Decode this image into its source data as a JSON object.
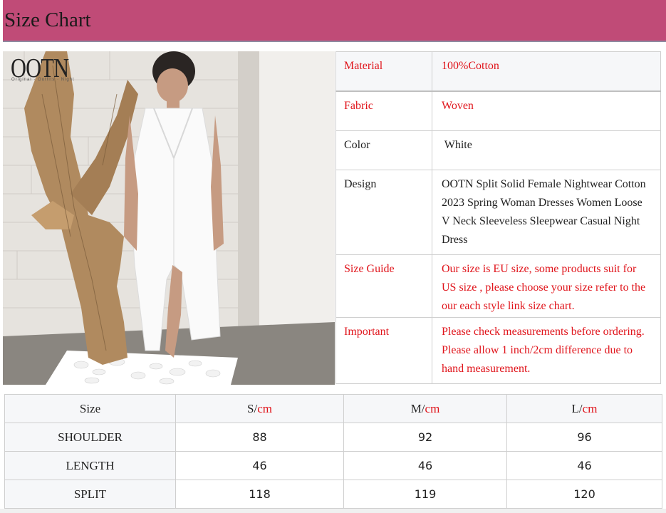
{
  "header": {
    "title": "Size Chart"
  },
  "photo": {
    "brand": "OOTN",
    "brand_tagline": "Original · Outfits · Night"
  },
  "spec": [
    {
      "label": "Material",
      "value": "100%Cotton",
      "color": "red"
    },
    {
      "label": "Fabric",
      "value": "Woven",
      "color": "red"
    },
    {
      "label": "Color",
      "value": " White",
      "color": "dark"
    },
    {
      "label": "Design",
      "value": "OOTN Split Solid Female Nightwear Cotton 2023 Spring Woman Dresses Women Loose V Neck Sleeveless Sleepwear Casual Night Dress",
      "color": "dark"
    },
    {
      "label": "Size Guide",
      "value": "Our size is EU size, some products suit for US size , please choose your size refer to the our each style link size chart.",
      "color": "red"
    },
    {
      "label": "Important",
      "value": "Please check measurements before ordering. Please allow 1 inch/2cm difference due to hand measurement.",
      "color": "red"
    }
  ],
  "size_table": {
    "header": {
      "size": "Size",
      "s": "S/",
      "m": "M/",
      "l": "L/",
      "unit": "cm"
    },
    "rows": [
      {
        "label": "SHOULDER",
        "s": "88",
        "m": "92",
        "l": "96"
      },
      {
        "label": "LENGTH",
        "s": "46",
        "m": "46",
        "l": "46"
      },
      {
        "label": "SPLIT",
        "s": "118",
        "m": "119",
        "l": "120"
      }
    ]
  },
  "colors": {
    "header_bg": "#c04b77",
    "accent_red": "#e0141b"
  }
}
